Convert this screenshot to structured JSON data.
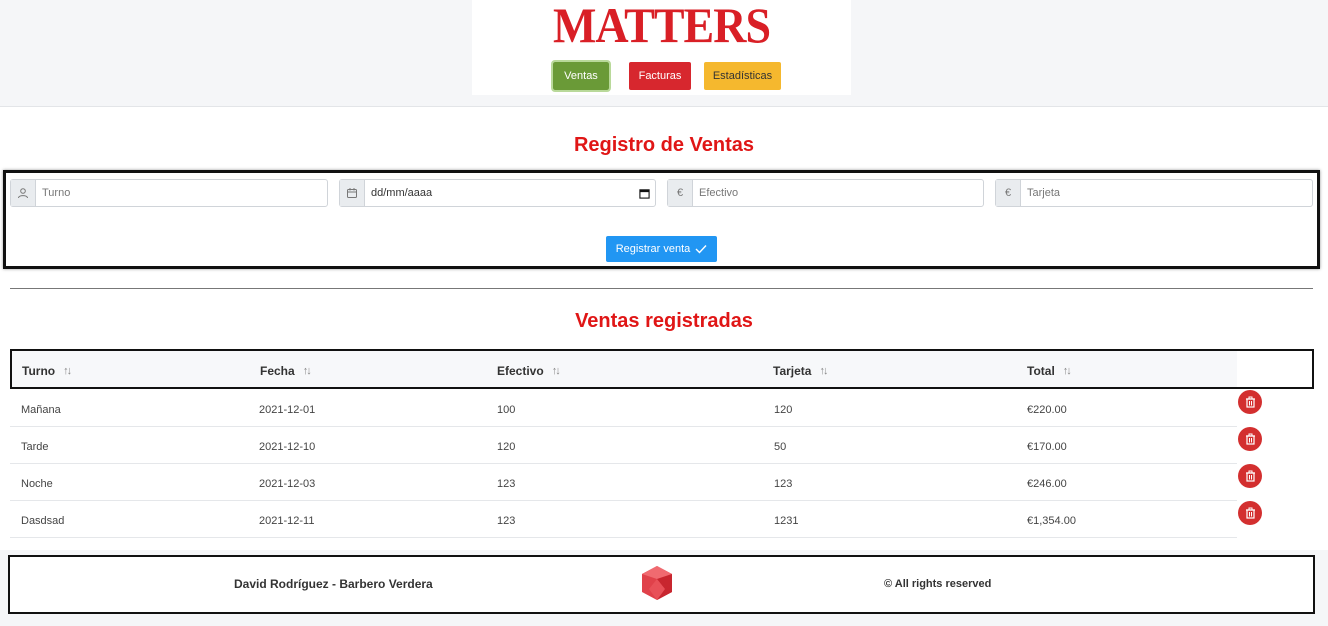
{
  "header": {
    "logo_text": "MATTERS",
    "nav": [
      {
        "label": "Ventas",
        "color": "#6a9a37"
      },
      {
        "label": "Facturas",
        "color": "#d7272e"
      },
      {
        "label": "Estadísticas",
        "color": "#f5b82e"
      }
    ]
  },
  "form": {
    "title": "Registro de Ventas",
    "turno_placeholder": "Turno",
    "fecha_placeholder": "dd/mm/aaaa",
    "efectivo_placeholder": "Efectivo",
    "tarjeta_placeholder": "Tarjeta",
    "currency_symbol": "€",
    "submit_label": "Registrar venta"
  },
  "table": {
    "title": "Ventas registradas",
    "columns": [
      "Turno",
      "Fecha",
      "Efectivo",
      "Tarjeta",
      "Total"
    ],
    "rows": [
      [
        "Mañana",
        "2021-12-01",
        "100",
        "120",
        "€220.00"
      ],
      [
        "Tarde",
        "2021-12-10",
        "120",
        "50",
        "€170.00"
      ],
      [
        "Noche",
        "2021-12-03",
        "123",
        "123",
        "€246.00"
      ],
      [
        "Dasdsad",
        "2021-12-11",
        "123",
        "1231",
        "€1,354.00"
      ]
    ]
  },
  "footer": {
    "author": "David Rodríguez - Barbero Verdera",
    "rights": "© All rights reserved"
  },
  "colors": {
    "accent_red": "#e01616",
    "primary_blue": "#2196f3",
    "delete_red": "#d32f2f"
  }
}
